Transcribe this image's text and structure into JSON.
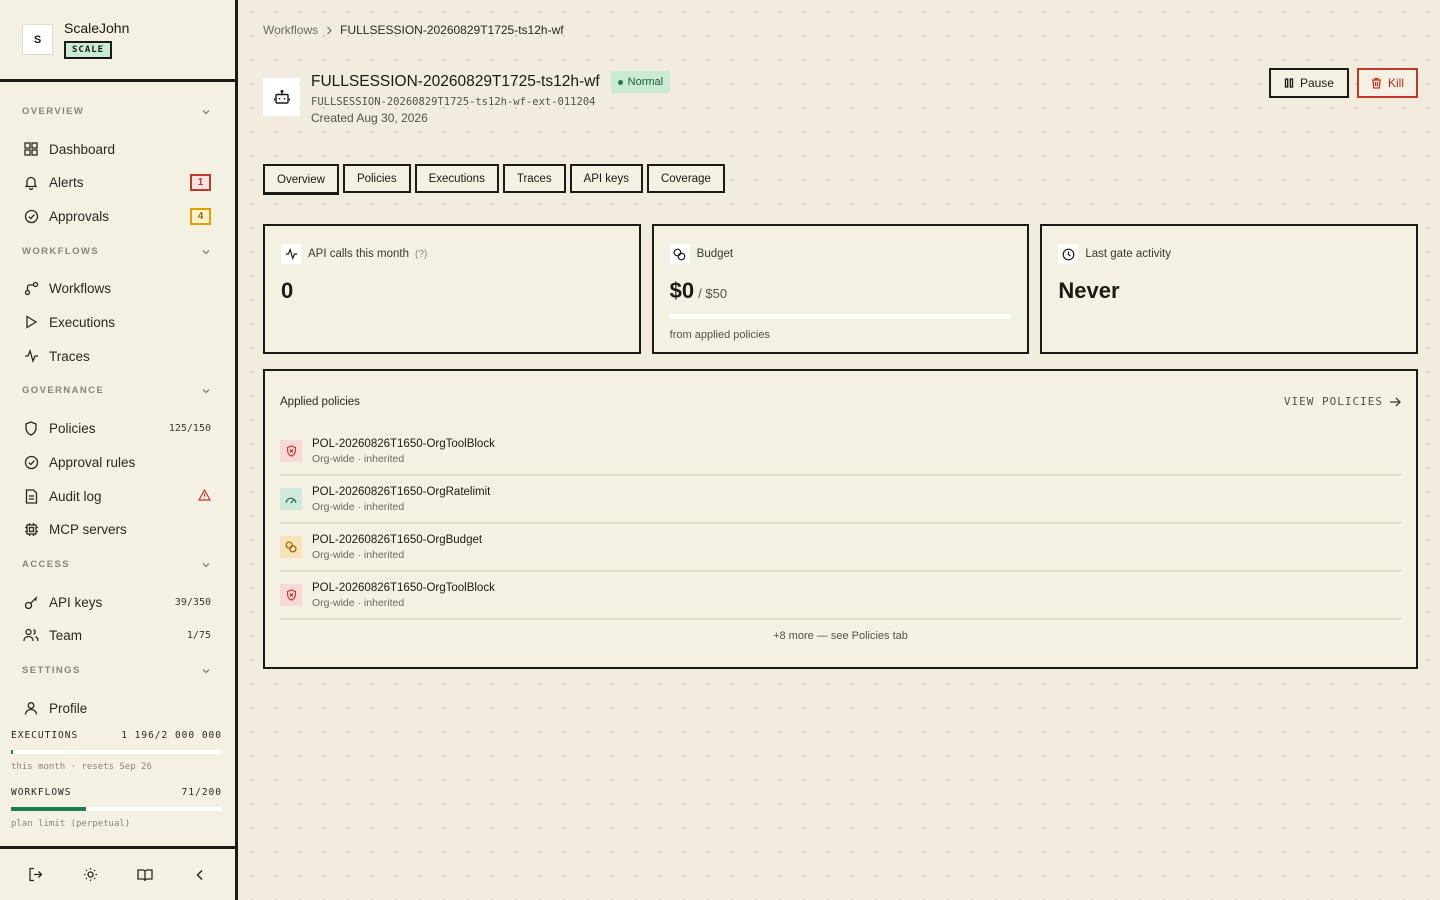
{
  "sidebar": {
    "brand": {
      "logo_letter": "S",
      "name": "ScaleJohn",
      "plan": "SCALE"
    },
    "sections": {
      "overview": "OVERVIEW",
      "workflows": "WORKFLOWS",
      "governance": "GOVERNANCE",
      "access": "ACCESS",
      "settings": "SETTINGS"
    },
    "items": {
      "dashboard": {
        "label": "Dashboard"
      },
      "alerts": {
        "label": "Alerts",
        "badge": "1"
      },
      "approvals": {
        "label": "Approvals",
        "badge": "4"
      },
      "workflows": {
        "label": "Workflows"
      },
      "executions": {
        "label": "Executions"
      },
      "traces": {
        "label": "Traces"
      },
      "policies": {
        "label": "Policies",
        "count": "125/150"
      },
      "approval_rules": {
        "label": "Approval rules"
      },
      "audit_log": {
        "label": "Audit log",
        "alert_icon": "warning-icon"
      },
      "mcp_servers": {
        "label": "MCP servers"
      },
      "api_keys": {
        "label": "API keys",
        "count": "39/350"
      },
      "team": {
        "label": "Team",
        "count": "1/75"
      },
      "profile": {
        "label": "Profile"
      }
    },
    "usage": {
      "executions": {
        "label": "EXECUTIONS",
        "value": "1 196/2 000 000",
        "fraction": 0.0006,
        "note": "this month · resets Sep 26"
      },
      "workflows": {
        "label": "WORKFLOWS",
        "value": "71/200",
        "fraction": 0.355,
        "note": "plan limit (perpetual)"
      }
    },
    "footer_icons": [
      "logout-icon",
      "theme-sun-icon",
      "docs-book-icon",
      "collapse-chevron-icon"
    ]
  },
  "breadcrumb": {
    "parent": "Workflows",
    "current": "FULLSESSION-20260829T1725-ts12h-wf"
  },
  "workflow": {
    "title": "FULLSESSION-20260829T1725-ts12h-wf",
    "status": "Normal",
    "external_id": "FULLSESSION-20260829T1725-ts12h-wf-ext-011204",
    "created": "Created Aug 30, 2026"
  },
  "actions": {
    "pause": "Pause",
    "kill": "Kill"
  },
  "tabs": [
    "Overview",
    "Policies",
    "Executions",
    "Traces",
    "API keys",
    "Coverage"
  ],
  "active_tab": "Overview",
  "cards": {
    "api_calls": {
      "label": "API calls this month",
      "help": "(?)",
      "value": "0"
    },
    "budget": {
      "label": "Budget",
      "value": "$0",
      "limit": "/ $50",
      "fraction": 0,
      "note": "from applied policies"
    },
    "last_gate": {
      "label": "Last gate activity",
      "value": "Never"
    }
  },
  "policies": {
    "title": "Applied policies",
    "view_link": "VIEW POLICIES",
    "items": [
      {
        "name": "POL-20260826T1650-OrgToolBlock",
        "sub": "Org-wide · inherited",
        "icon": "shield-x-icon",
        "tone": "red"
      },
      {
        "name": "POL-20260826T1650-OrgRatelimit",
        "sub": "Org-wide · inherited",
        "icon": "gauge-icon",
        "tone": "green"
      },
      {
        "name": "POL-20260826T1650-OrgBudget",
        "sub": "Org-wide · inherited",
        "icon": "coins-icon",
        "tone": "amber"
      },
      {
        "name": "POL-20260826T1650-OrgToolBlock",
        "sub": "Org-wide · inherited",
        "icon": "shield-x-icon",
        "tone": "red"
      }
    ],
    "more": "+8 more — see Policies tab"
  },
  "colors": {
    "accent_green": "#1d7f4d",
    "danger": "#c0392b",
    "warning": "#e0a100",
    "background": "#f1ecdd"
  }
}
